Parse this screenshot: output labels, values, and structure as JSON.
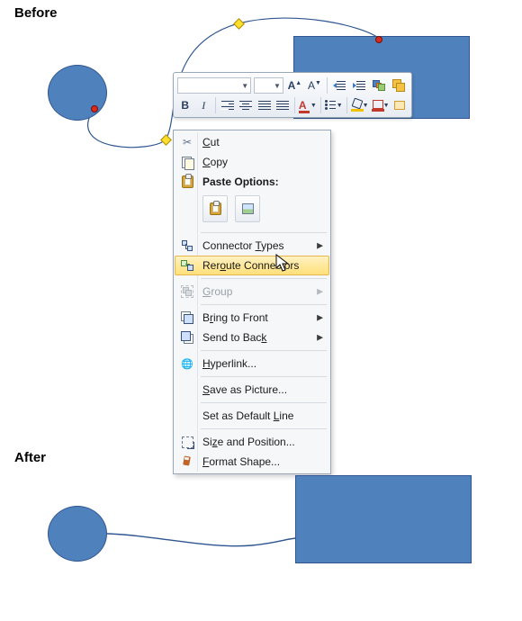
{
  "labels": {
    "before": "Before",
    "after": "After"
  },
  "toolbar": {
    "font_family": "",
    "font_size": "",
    "grow_font": "A▲",
    "shrink_font": "A▼",
    "bold": "B",
    "italic": "I",
    "font_color_letter": "A"
  },
  "context_menu": {
    "cut": "Cut",
    "copy": "Copy",
    "paste_header": "Paste Options:",
    "connector_types": "Connector Types",
    "reroute": "Reroute Connectors",
    "group": "Group",
    "bring_front": "Bring to Front",
    "send_back": "Send to Back",
    "hyperlink": "Hyperlink...",
    "save_picture": "Save as Picture...",
    "default_line": "Set as Default Line",
    "size_position": "Size and Position...",
    "format_shape": "Format Shape..."
  }
}
